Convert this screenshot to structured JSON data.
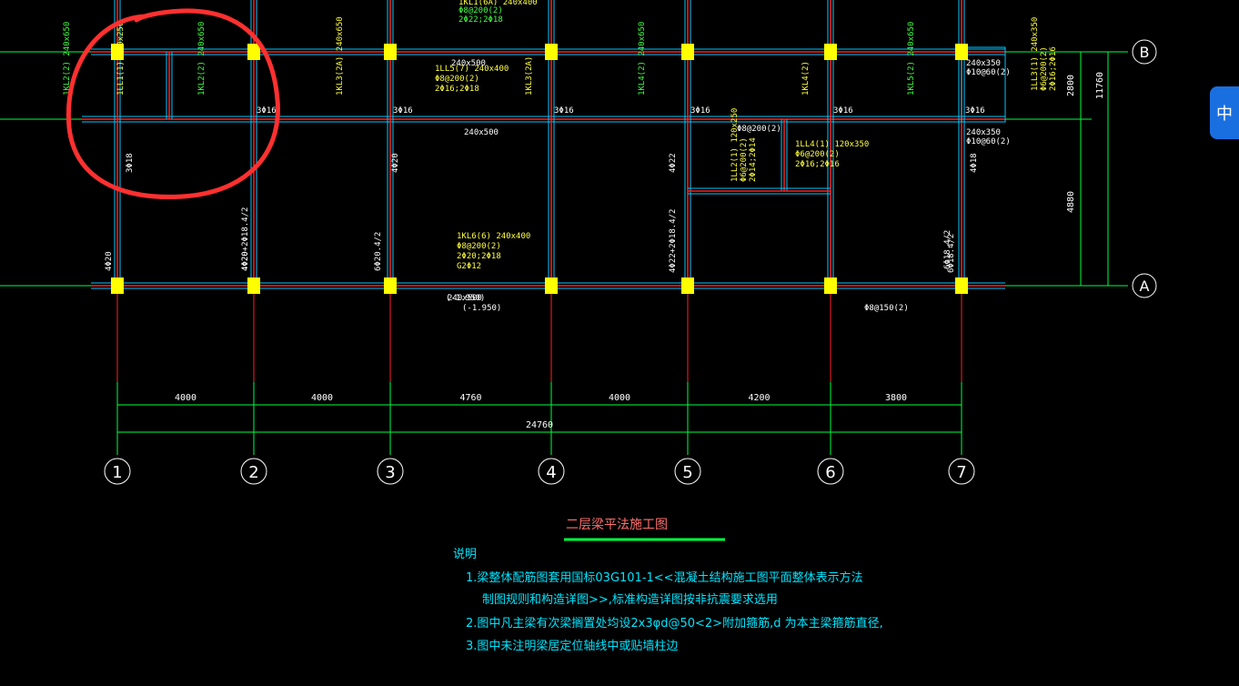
{
  "drawing": {
    "title": "二层梁平法施工图",
    "notes_heading": "说明",
    "notes": [
      "1.梁整体配筋图套用国标03G101-1<<混凝土结构施工图平面整体表示方法",
      "制图规则和构造详图>>,标准构造详图按非抗震要求选用",
      "2.图中凡主梁有次梁搁置处均设2x3φd@50<2>附加箍筋,d 为本主梁箍筋直径,",
      "3.图中未注明梁居定位轴线中或贴墙柱边"
    ],
    "axis_labels_x": [
      "1",
      "2",
      "3",
      "4",
      "5",
      "6",
      "7"
    ],
    "axis_labels_y": [
      "B",
      "A"
    ],
    "dimensions_x": [
      "4000",
      "4000",
      "4760",
      "4000",
      "4200",
      "3800"
    ],
    "dimension_total": "24760",
    "dimensions_y": [
      "2800",
      "4880"
    ],
    "dimension_y_total": "11760",
    "beam_labels": [
      {
        "text": "1KL1(6A) 240x400",
        "color": "#ffff40"
      },
      {
        "text": "Φ8@200(2)",
        "color": "#40ff40"
      },
      {
        "text": "2Φ22;2Φ18",
        "color": "#40ff40"
      },
      {
        "text": "1LL5(7) 240x400",
        "color": "#ffff40"
      },
      {
        "text": "Φ8@200(2)",
        "color": "#ffff40"
      },
      {
        "text": "2Φ16;2Φ18",
        "color": "#ffff40"
      },
      {
        "text": "1KL6(6) 240x400",
        "color": "#ffff40"
      },
      {
        "text": "Φ8@200(2)",
        "color": "#ffff40"
      },
      {
        "text": "2Φ20;2Φ18",
        "color": "#ffff40"
      },
      {
        "text": "G2Φ12",
        "color": "#ffff40"
      },
      {
        "text": "240x500",
        "color": "#ffffff"
      },
      {
        "text": "(-1.950)",
        "color": "#ffffff"
      },
      {
        "text": "240x500",
        "color": "#ffffff"
      },
      {
        "text": "240x500",
        "color": "#ffffff"
      },
      {
        "text": "(-1.950)",
        "color": "#ffffff"
      },
      {
        "text": "Φ8@150(2)",
        "color": "#ffffff"
      },
      {
        "text": "240x350",
        "color": "#ffffff"
      },
      {
        "text": "Φ10@60(2)",
        "color": "#ffffff"
      },
      {
        "text": "240x350",
        "color": "#ffffff"
      },
      {
        "text": "Φ10@60(2)",
        "color": "#ffffff"
      },
      {
        "text": "Φ8@200(2)",
        "color": "#ffffff"
      },
      {
        "text": "1LL4(1) 120x350",
        "color": "#ffff40"
      },
      {
        "text": "Φ6@200(2)",
        "color": "#ffff40"
      },
      {
        "text": "2Φ16;2Φ16",
        "color": "#ffff40"
      },
      {
        "text": "1LL2(1) 120x250",
        "color": "#ffff40"
      },
      {
        "text": "Φ6@200(2)",
        "color": "#ffff40"
      },
      {
        "text": "2Φ14;2Φ14",
        "color": "#ffff40"
      },
      {
        "text": "1LL3(1) 240x350",
        "color": "#ffff40"
      },
      {
        "text": "Φ6@200(2)",
        "color": "#ffff40"
      },
      {
        "text": "2Φ16;2Φ16",
        "color": "#ffff40"
      }
    ],
    "small_labels": [
      "3Φ16",
      "3Φ16",
      "3Φ16",
      "3Φ16",
      "3Φ16",
      "3Φ16",
      "4Φ20",
      "4Φ20",
      "4Φ22",
      "4Φ18",
      "3Φ18",
      "4Φ20",
      "6Φ18.4/2",
      "4Φ20+2Φ18.4/2",
      "6Φ20.4/2",
      "4Φ22+2Φ18.4/2",
      "6Φ18.4/2"
    ],
    "vertical_labels": [
      {
        "text": "1KL2(2) 240x650",
        "color": "#40ff40"
      },
      {
        "text": "1LL1(1) 120x250",
        "color": "#ffff40"
      },
      {
        "text": "1KL2(2) 240x650",
        "color": "#40ff40"
      },
      {
        "text": "1KL3(2A) 240x650",
        "color": "#ffff40"
      },
      {
        "text": "1KL3(2A)",
        "color": "#ffff40"
      },
      {
        "text": "1KL4(2) 240x650",
        "color": "#40ff40"
      },
      {
        "text": "1KL4(2)",
        "color": "#ffff40"
      },
      {
        "text": "1KL5(2) 240x650",
        "color": "#40ff40"
      }
    ]
  },
  "ime": {
    "label": "中"
  },
  "colors": {
    "background": "#000000",
    "grid": "#00ff40",
    "beam": "#00c8ff",
    "beam_center": "#ff2020",
    "column": "#ffff00",
    "annotation_circle": "#ff3030"
  }
}
